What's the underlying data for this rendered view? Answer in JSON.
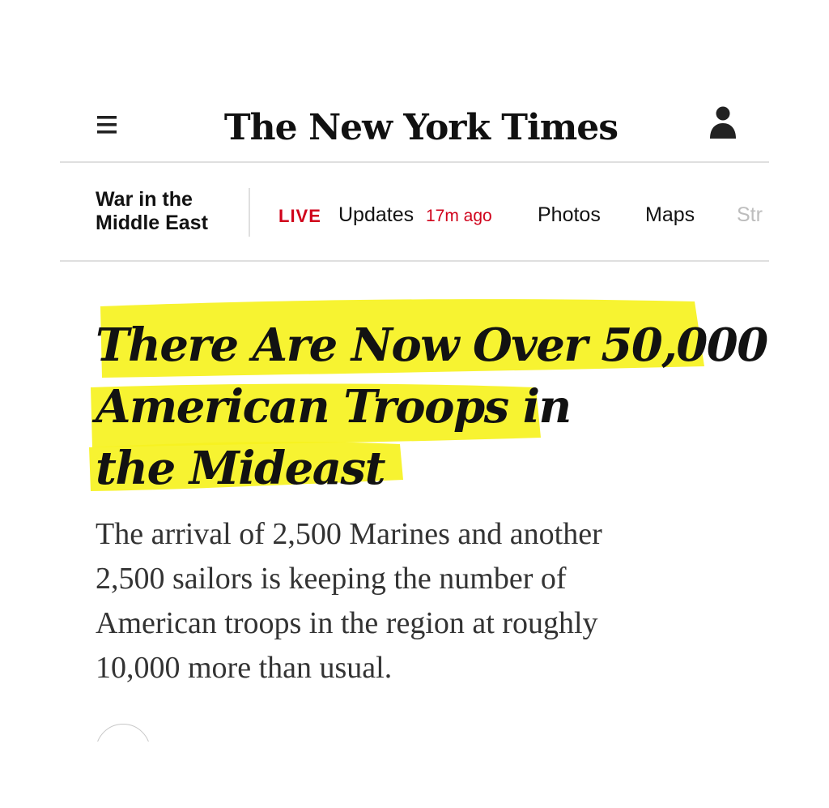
{
  "header": {
    "masthead": "The New York Times",
    "menu_icon": "hamburger-menu-icon",
    "account_icon": "user-account-icon"
  },
  "nav": {
    "section_label": "War in the Middle East",
    "live_badge": "LIVE",
    "updates_label": "Updates",
    "updates_time": "17m ago",
    "items": [
      "Photos",
      "Maps",
      "Str"
    ]
  },
  "article": {
    "headline_lines": [
      "There Are Now Over 50,000",
      "American Troops in",
      "the Mideast"
    ],
    "summary_lines": [
      "The arrival of 2,500 Marines and another",
      "2,500 sailors is keeping the number of",
      "American troops in the region at roughly",
      "10,000 more than usual."
    ]
  },
  "colors": {
    "highlight": "#f5f11a",
    "live_red": "#d0021b",
    "text": "#121212"
  }
}
